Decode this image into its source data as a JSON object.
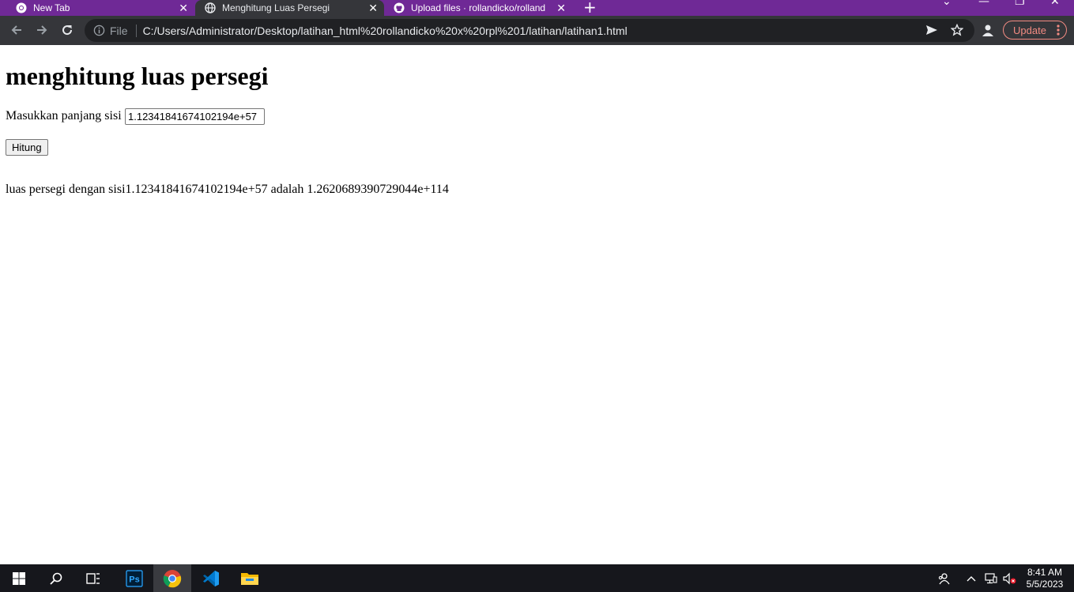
{
  "browser": {
    "tabs": [
      {
        "title": "New Tab",
        "icon": "chrome-icon"
      },
      {
        "title": "Menghitung Luas Persegi",
        "icon": "globe-icon"
      },
      {
        "title": "Upload files · rollandicko/rolland",
        "icon": "github-icon"
      }
    ],
    "close_glyph": "✕",
    "newtab_glyph": "+",
    "address": {
      "scheme_label": "File",
      "url": "C:/Users/Administrator/Desktop/latihan_html%20rollandicko%20x%20rpl%201/latihan/latihan1.html"
    },
    "update_label": "Update",
    "accent": "#6f2996"
  },
  "page": {
    "heading": "menghitung luas persegi",
    "input_label": "Masukkan panjang sisi",
    "input_value": "1.12341841674102194e+57",
    "button_label": "Hitung",
    "result_text": "luas persegi dengan sisi1.12341841674102194e+57 adalah 1.2620689390729044e+114"
  },
  "taskbar": {
    "time": "8:41 AM",
    "date": "5/5/2023",
    "apps": [
      "windows-start-icon",
      "search-icon",
      "task-view-icon",
      "photoshop-icon",
      "chrome-icon",
      "vscode-icon",
      "file-explorer-icon"
    ]
  }
}
